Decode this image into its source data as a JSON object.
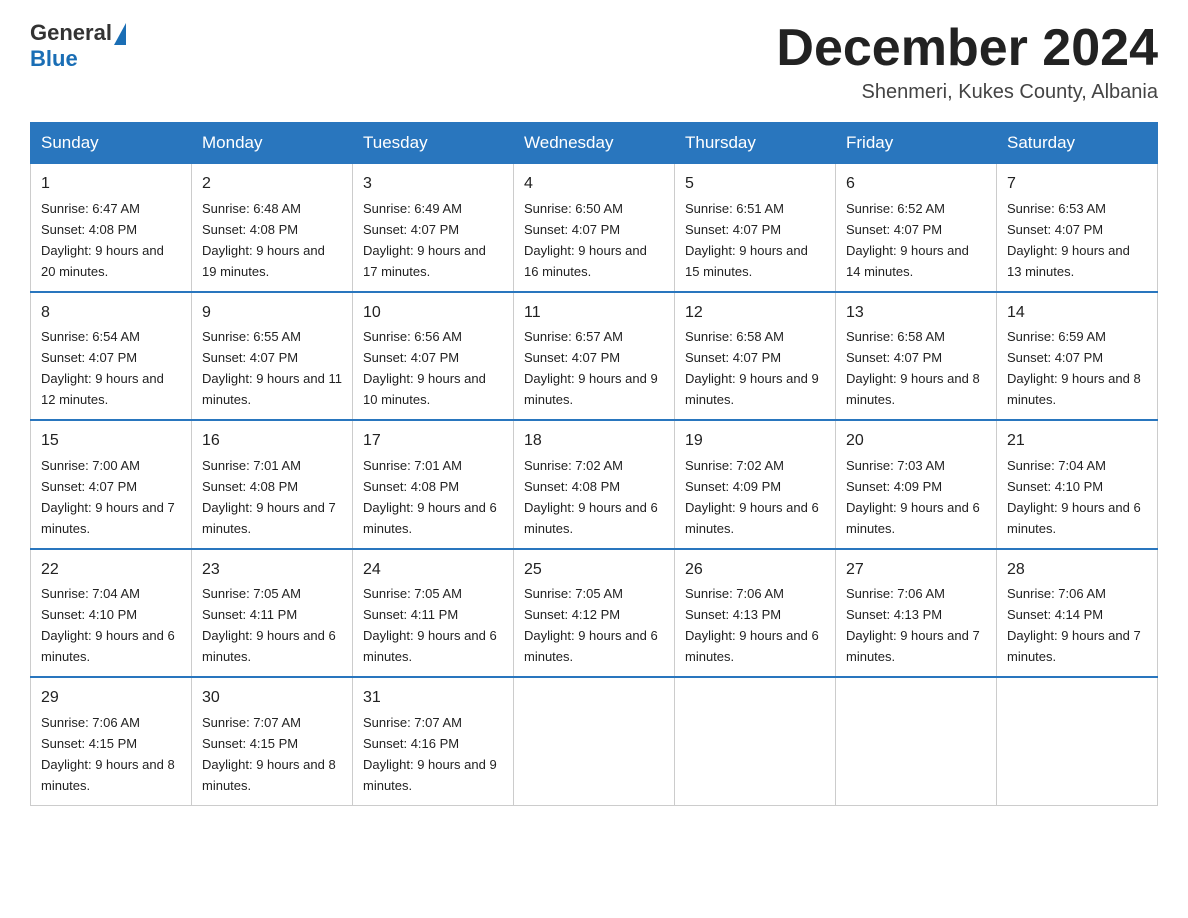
{
  "header": {
    "logo_general": "General",
    "logo_blue": "Blue",
    "month_title": "December 2024",
    "location": "Shenmeri, Kukes County, Albania"
  },
  "days_of_week": [
    "Sunday",
    "Monday",
    "Tuesday",
    "Wednesday",
    "Thursday",
    "Friday",
    "Saturday"
  ],
  "weeks": [
    [
      {
        "day": "1",
        "sunrise": "6:47 AM",
        "sunset": "4:08 PM",
        "daylight": "9 hours and 20 minutes."
      },
      {
        "day": "2",
        "sunrise": "6:48 AM",
        "sunset": "4:08 PM",
        "daylight": "9 hours and 19 minutes."
      },
      {
        "day": "3",
        "sunrise": "6:49 AM",
        "sunset": "4:07 PM",
        "daylight": "9 hours and 17 minutes."
      },
      {
        "day": "4",
        "sunrise": "6:50 AM",
        "sunset": "4:07 PM",
        "daylight": "9 hours and 16 minutes."
      },
      {
        "day": "5",
        "sunrise": "6:51 AM",
        "sunset": "4:07 PM",
        "daylight": "9 hours and 15 minutes."
      },
      {
        "day": "6",
        "sunrise": "6:52 AM",
        "sunset": "4:07 PM",
        "daylight": "9 hours and 14 minutes."
      },
      {
        "day": "7",
        "sunrise": "6:53 AM",
        "sunset": "4:07 PM",
        "daylight": "9 hours and 13 minutes."
      }
    ],
    [
      {
        "day": "8",
        "sunrise": "6:54 AM",
        "sunset": "4:07 PM",
        "daylight": "9 hours and 12 minutes."
      },
      {
        "day": "9",
        "sunrise": "6:55 AM",
        "sunset": "4:07 PM",
        "daylight": "9 hours and 11 minutes."
      },
      {
        "day": "10",
        "sunrise": "6:56 AM",
        "sunset": "4:07 PM",
        "daylight": "9 hours and 10 minutes."
      },
      {
        "day": "11",
        "sunrise": "6:57 AM",
        "sunset": "4:07 PM",
        "daylight": "9 hours and 9 minutes."
      },
      {
        "day": "12",
        "sunrise": "6:58 AM",
        "sunset": "4:07 PM",
        "daylight": "9 hours and 9 minutes."
      },
      {
        "day": "13",
        "sunrise": "6:58 AM",
        "sunset": "4:07 PM",
        "daylight": "9 hours and 8 minutes."
      },
      {
        "day": "14",
        "sunrise": "6:59 AM",
        "sunset": "4:07 PM",
        "daylight": "9 hours and 8 minutes."
      }
    ],
    [
      {
        "day": "15",
        "sunrise": "7:00 AM",
        "sunset": "4:07 PM",
        "daylight": "9 hours and 7 minutes."
      },
      {
        "day": "16",
        "sunrise": "7:01 AM",
        "sunset": "4:08 PM",
        "daylight": "9 hours and 7 minutes."
      },
      {
        "day": "17",
        "sunrise": "7:01 AM",
        "sunset": "4:08 PM",
        "daylight": "9 hours and 6 minutes."
      },
      {
        "day": "18",
        "sunrise": "7:02 AM",
        "sunset": "4:08 PM",
        "daylight": "9 hours and 6 minutes."
      },
      {
        "day": "19",
        "sunrise": "7:02 AM",
        "sunset": "4:09 PM",
        "daylight": "9 hours and 6 minutes."
      },
      {
        "day": "20",
        "sunrise": "7:03 AM",
        "sunset": "4:09 PM",
        "daylight": "9 hours and 6 minutes."
      },
      {
        "day": "21",
        "sunrise": "7:04 AM",
        "sunset": "4:10 PM",
        "daylight": "9 hours and 6 minutes."
      }
    ],
    [
      {
        "day": "22",
        "sunrise": "7:04 AM",
        "sunset": "4:10 PM",
        "daylight": "9 hours and 6 minutes."
      },
      {
        "day": "23",
        "sunrise": "7:05 AM",
        "sunset": "4:11 PM",
        "daylight": "9 hours and 6 minutes."
      },
      {
        "day": "24",
        "sunrise": "7:05 AM",
        "sunset": "4:11 PM",
        "daylight": "9 hours and 6 minutes."
      },
      {
        "day": "25",
        "sunrise": "7:05 AM",
        "sunset": "4:12 PM",
        "daylight": "9 hours and 6 minutes."
      },
      {
        "day": "26",
        "sunrise": "7:06 AM",
        "sunset": "4:13 PM",
        "daylight": "9 hours and 6 minutes."
      },
      {
        "day": "27",
        "sunrise": "7:06 AM",
        "sunset": "4:13 PM",
        "daylight": "9 hours and 7 minutes."
      },
      {
        "day": "28",
        "sunrise": "7:06 AM",
        "sunset": "4:14 PM",
        "daylight": "9 hours and 7 minutes."
      }
    ],
    [
      {
        "day": "29",
        "sunrise": "7:06 AM",
        "sunset": "4:15 PM",
        "daylight": "9 hours and 8 minutes."
      },
      {
        "day": "30",
        "sunrise": "7:07 AM",
        "sunset": "4:15 PM",
        "daylight": "9 hours and 8 minutes."
      },
      {
        "day": "31",
        "sunrise": "7:07 AM",
        "sunset": "4:16 PM",
        "daylight": "9 hours and 9 minutes."
      },
      null,
      null,
      null,
      null
    ]
  ]
}
